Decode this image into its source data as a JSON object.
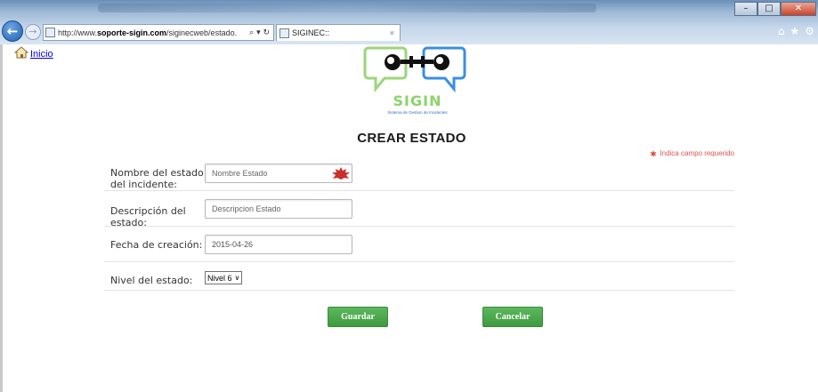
{
  "browser": {
    "address": {
      "prefix": "http://www.",
      "domain": "soporte-sigin.com",
      "path": "/siginecweb/estado.",
      "tools": "⌕ ▾ ↻"
    },
    "tab": {
      "title": "SIGINEC::",
      "close": "×"
    },
    "back_icon": "←",
    "forward_icon": "→",
    "window_buttons": [
      "–",
      "□",
      "✕"
    ],
    "right_icons": [
      "⌂",
      "★",
      "⚙"
    ]
  },
  "nav": {
    "home_label": "Inicio"
  },
  "logo": {
    "name": "SIGIN",
    "subtitle": "Sistema de Gestion de Incidentes"
  },
  "page_title": "CREAR ESTADO",
  "required_note": "Indica campo requerido",
  "form": {
    "name_label": "Nombre del estado del incidente:",
    "name_placeholder": "Nombre Estado",
    "desc_label": "Descripción del estado:",
    "desc_placeholder": "Descripcion Estado",
    "date_label": "Fecha de creación:",
    "date_value": "2015-04-26",
    "level_label": "Nivel del estado:",
    "level_value": "Nivel 6"
  },
  "buttons": {
    "save": "Guardar",
    "cancel": "Cancelar"
  },
  "colors": {
    "button_green": "#4cae4c",
    "required_red": "#d9534f",
    "logo_green": "#8cd46a",
    "logo_blue": "#3a8fe0",
    "link_blue": "#0000ee"
  }
}
